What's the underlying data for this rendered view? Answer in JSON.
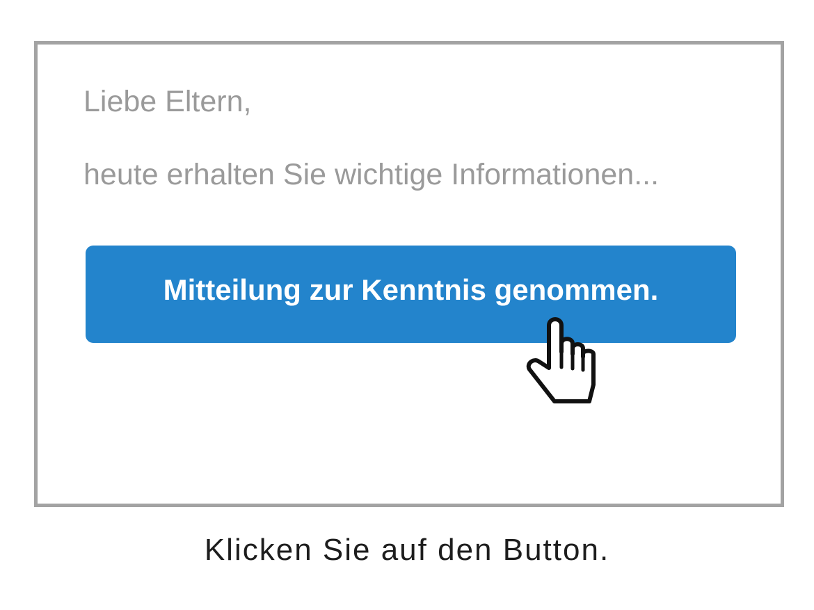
{
  "message": {
    "greeting": "Liebe Eltern,",
    "intro": "heute erhalten Sie wichtige Informationen..."
  },
  "button": {
    "label": "Mitteilung zur Kenntnis genommen.",
    "color": "#2384cc"
  },
  "cursor": {
    "icon": "pointing-hand-icon"
  },
  "instruction": "Klicken Sie auf den Button."
}
